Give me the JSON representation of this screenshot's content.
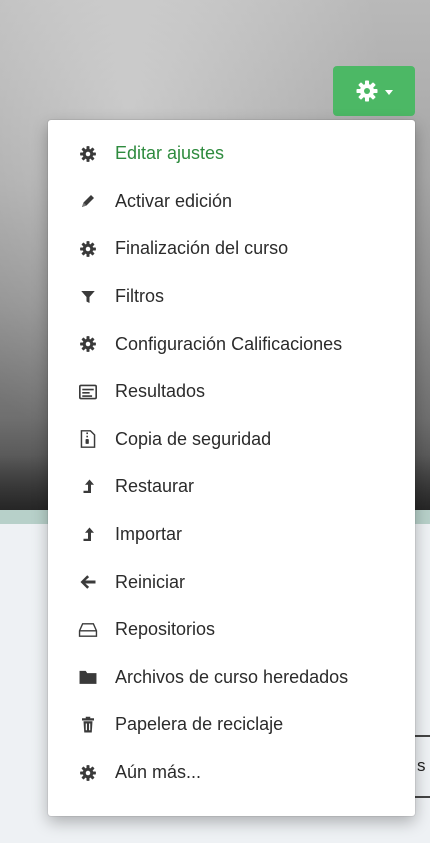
{
  "toggle": {
    "aria_label": "Actions menu"
  },
  "menu": {
    "items": [
      {
        "label": "Editar ajustes",
        "icon": "gear-icon",
        "active": true
      },
      {
        "label": "Activar edición",
        "icon": "pencil-icon"
      },
      {
        "label": "Finalización del curso",
        "icon": "gear-icon"
      },
      {
        "label": "Filtros",
        "icon": "filter-icon"
      },
      {
        "label": "Configuración Calificaciones",
        "icon": "gear-icon"
      },
      {
        "label": "Resultados",
        "icon": "list-card-icon"
      },
      {
        "label": "Copia de seguridad",
        "icon": "file-archive-icon"
      },
      {
        "label": "Restaurar",
        "icon": "level-up-icon"
      },
      {
        "label": "Importar",
        "icon": "level-up-icon"
      },
      {
        "label": "Reiniciar",
        "icon": "arrow-left-icon"
      },
      {
        "label": "Repositorios",
        "icon": "hard-drive-icon"
      },
      {
        "label": "Archivos de curso heredados",
        "icon": "folder-icon"
      },
      {
        "label": "Papelera de reciclaje",
        "icon": "trash-icon"
      },
      {
        "label": "Aún más...",
        "icon": "gear-icon"
      }
    ]
  },
  "background": {
    "edge_letter": "s"
  },
  "colors": {
    "accent": "#4cb865",
    "active_text": "#2e8b3e",
    "icon": "#3a3a3a"
  }
}
